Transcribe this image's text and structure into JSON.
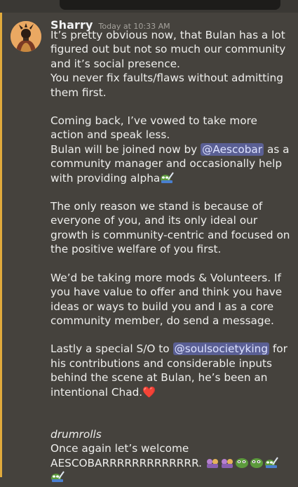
{
  "message": {
    "author": "Sharry",
    "timestamp": "Today at 10:33 AM",
    "paragraphs": {
      "p1_line1": "It’s pretty obvious now, that Bulan has a lot figured out but not so much our community and it’s social presence.",
      "p1_line2": "You never fix faults/flaws without admitting them first.",
      "p2_line1": "Coming back, I’ve vowed to take more action and speak less.",
      "p2_line2_pre": "Bulan will be joined now by ",
      "p2_mention": "@Aescobar",
      "p2_line2_post": " as a community manager and occasionally help with providing alpha",
      "p3": "The only reason we stand is because of everyone of you, and its only ideal our growth is community-centric and focused on the positive welfare of you first.",
      "p4": "We’d be taking more mods & Volunteers. If you have value to offer and think you have ideas or ways to build you and I as a core community member, do send a message.",
      "p5_pre": "Lastly a special S/O to ",
      "p5_mention": "@soulsocietyking",
      "p5_post": " for his contributions and considerable inputs behind the scene at Bulan, he’s been an intentional Chad.",
      "p5_heart": "❤️",
      "p6_italic": "drumrolls",
      "p6_line2": "Once again let’s welcome",
      "p6_line3": "AESCOBARRRRRRRRRRRRR."
    },
    "emojis": {
      "alpha": "pepe-writing-emoji",
      "closing": [
        "pepe-dance-emoji",
        "pepe-dance-emoji",
        "pepe-cute-emoji",
        "pepe-cute-emoji",
        "pepe-writing-emoji",
        "pepe-writing-emoji"
      ]
    },
    "colors": {
      "background": "#45423d",
      "mention_bg": "#5a5f94",
      "mention_text": "#dde2ff",
      "highlight_stripe": "#e1aa3c"
    }
  }
}
